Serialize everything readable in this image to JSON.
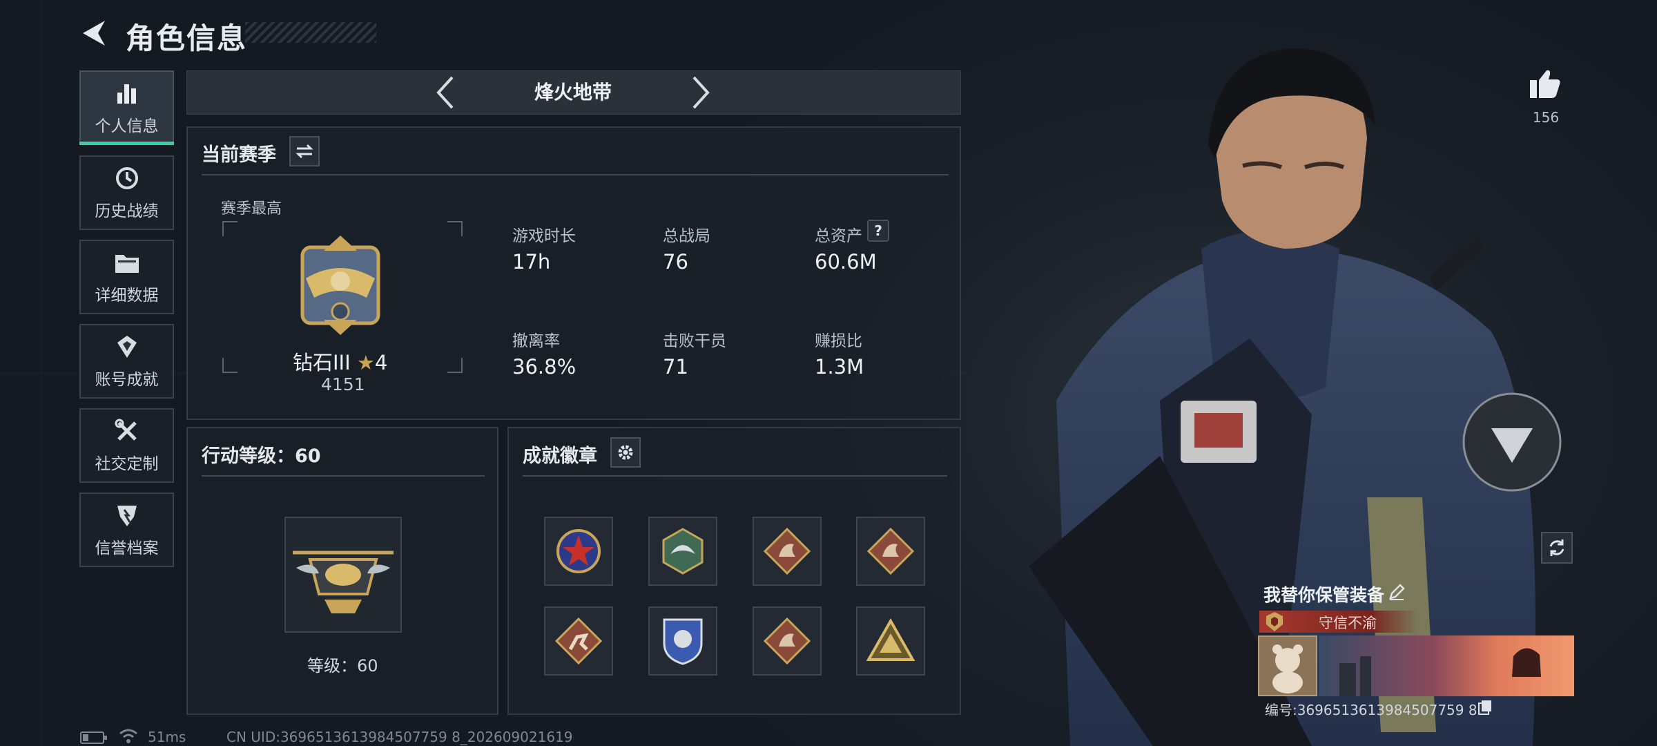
{
  "header": {
    "title": "角色信息"
  },
  "sidebar": {
    "items": [
      {
        "label": "个人信息",
        "icon": "bar-chart-icon",
        "active": true
      },
      {
        "label": "历史战绩",
        "icon": "history-icon"
      },
      {
        "label": "详细数据",
        "icon": "folder-icon"
      },
      {
        "label": "账号成就",
        "icon": "achievement-icon"
      },
      {
        "label": "社交定制",
        "icon": "tools-icon"
      },
      {
        "label": "信誉档案",
        "icon": "credit-icon"
      }
    ]
  },
  "mode": {
    "name": "烽火地带"
  },
  "season": {
    "title": "当前赛季",
    "highest_label": "赛季最高",
    "rank": "钻石III",
    "stars": "4",
    "score": "4151",
    "stats": [
      {
        "label": "游戏时长",
        "value": "17h"
      },
      {
        "label": "总战局",
        "value": "76"
      },
      {
        "label": "总资产",
        "value": "60.6M"
      },
      {
        "label": "撤离率",
        "value": "36.8%"
      },
      {
        "label": "击败干员",
        "value": "71"
      },
      {
        "label": "赚损比",
        "value": "1.3M"
      }
    ]
  },
  "level": {
    "title": "行动等级：60",
    "caption": "等级：60"
  },
  "achievements": {
    "title": "成就徽章",
    "badges": [
      {
        "icon": "star-emblem-icon",
        "color": "#c8302a"
      },
      {
        "icon": "wing-hex-icon",
        "color": "#3f6b55"
      },
      {
        "icon": "dragon-diamond-icon",
        "color": "#8a4a3a"
      },
      {
        "icon": "dragon-diamond-icon",
        "color": "#8a4a3a"
      },
      {
        "icon": "runner-diamond-icon",
        "color": "#8a4a3a"
      },
      {
        "icon": "shield-crest-icon",
        "color": "#3b5bb0"
      },
      {
        "icon": "dragon-diamond-icon",
        "color": "#8a4a3a"
      },
      {
        "icon": "triangle-gold-icon",
        "color": "#b8892e"
      }
    ]
  },
  "status": {
    "ping": "51ms",
    "uid": "CN UID:3696513613984507759 8_202609021619"
  },
  "profile": {
    "likes": "156",
    "nickname": "我替你保管装备",
    "credit": "守信不渝",
    "id_line": "编号:3696513613984507759 8"
  },
  "colors": {
    "accent": "#34d1a4",
    "credit_bar": "#8c2a23"
  }
}
